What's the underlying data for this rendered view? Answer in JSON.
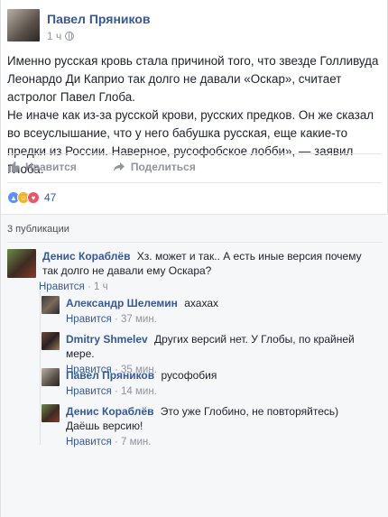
{
  "post": {
    "author": "Павел Пряников",
    "time": "1 ч",
    "text_lines": [
      "Именно русская кровь стала причиной того, что звезде Голливуда Леонардо Ди Каприо так долго не давали «Оскар», считает астролог Павел Глоба.",
      "Не иначе как из-за русской крови, русских предков. Он же сказал во всеуслышание, что у него бабушка русская, еще какие-то предки из России. Наверное, русофобское лобби», — заявил Глоба."
    ]
  },
  "actions": {
    "like": "Нравится",
    "share": "Поделиться"
  },
  "reactions": {
    "count": "47"
  },
  "shares": {
    "label": "3 публикации"
  },
  "comments": [
    {
      "author": "Денис Кораблёв",
      "text": "Хз. может и так.. А есть иные версия почему так долго не давали ему Оскара?",
      "like": "Нравится",
      "sep": "·",
      "time": "1 ч"
    },
    {
      "author": "Александр Шелемин",
      "text": "ахахах",
      "like": "Нравится",
      "sep": "·",
      "time": "37 мин."
    },
    {
      "author": "Dmitry Shmelev",
      "text": "Других версий нет. У Глобы, по крайней мере.",
      "like": "Нравится",
      "sep": "·",
      "time": "35 мин."
    },
    {
      "author": "Павел Пряников",
      "text": "русофобия",
      "like": "Нравится",
      "sep": "·",
      "time": "14 мин."
    },
    {
      "author": "Денис Кораблёв",
      "text": "Это уже Глобино, не повторяйтесь) Даёшь версию!",
      "like": "Нравится",
      "sep": "·",
      "time": "7 мин."
    }
  ]
}
